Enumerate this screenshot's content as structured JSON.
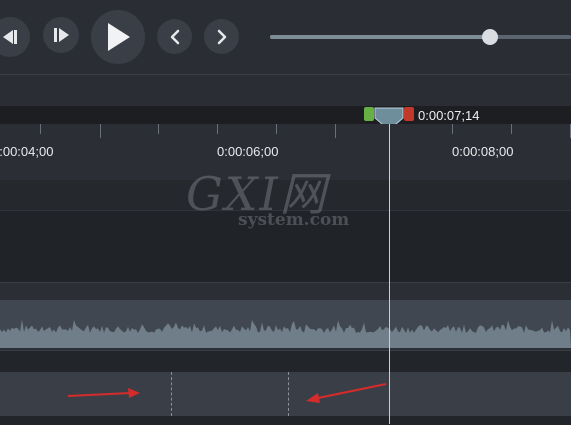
{
  "transport": {
    "buttons": [
      "step-back-icon",
      "step-forward-icon",
      "play-icon",
      "previous-icon",
      "next-icon"
    ],
    "scrub_position_fraction": 0.73
  },
  "playhead": {
    "time": "0:00:07;14"
  },
  "ruler": {
    "labels": [
      "0:00:04;00",
      "0:00:06;00",
      "0:00:08;00"
    ]
  },
  "watermark": {
    "main": "GXI网",
    "sub": "system.com"
  },
  "colors": {
    "background": "#22252a",
    "playhead_marker": "#6f8e9b",
    "in_marker": "#66b044",
    "out_marker": "#c0392b",
    "annotation_arrow": "#d62b2b",
    "audio_waveform": "#6f7e88"
  }
}
